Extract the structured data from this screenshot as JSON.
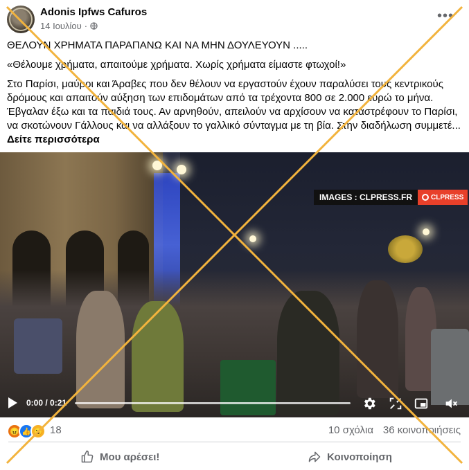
{
  "post": {
    "author": "Adonis Ipfws Cafuros",
    "date": "14 Ιουλίου",
    "headline": "ΘΕΛΟΥΝ ΧΡΗΜΑΤΑ ΠΑΡΑΠΑΝΩ ΚΑΙ ΝΑ ΜΗΝ ΔΟΥΛΕΥΟΥΝ .....",
    "quote": "«Θέλουμε χρήματα, απαιτούμε χρήματα. Χωρίς χρήματα είμαστε φτωχοί!»",
    "body": "Στο Παρίσι, μαύροι και Άραβες που δεν θέλουν να εργαστούν έχουν παραλύσει τους κεντρικούς δρόμους και απαιτούν αύξηση των επιδομάτων από τα τρέχοντα 800 σε 2.000 ευρώ το μήνα. Έβγαλαν έξω και τα παιδιά τους. Αν αρνηθούν, απειλούν να αρχίσουν να καταστρέφουν το Παρίσι, να σκοτώνουν Γάλλους και να αλλάξουν το γαλλικό σύνταγμα με τη βία. Στην διαδήλωση συμμετέ...",
    "see_more": "Δείτε περισσότερα"
  },
  "video": {
    "watermark_left": "IMAGES : CLPRESS.FR",
    "watermark_right": "CLPRESS",
    "time": "0:00 / 0:21",
    "progress": 0
  },
  "stats": {
    "reaction_count": "18",
    "comments": "10 σχόλια",
    "shares": "36 κοινοποιήσεις"
  },
  "actions": {
    "like": "Μου αρέσει!",
    "share": "Κοινοποίηση"
  },
  "colors": {
    "fact_check_cross": "#f2b33d",
    "like_blue": "#1877f2",
    "angry_orange": "#e9710f",
    "watermark_red": "#e8402a"
  }
}
